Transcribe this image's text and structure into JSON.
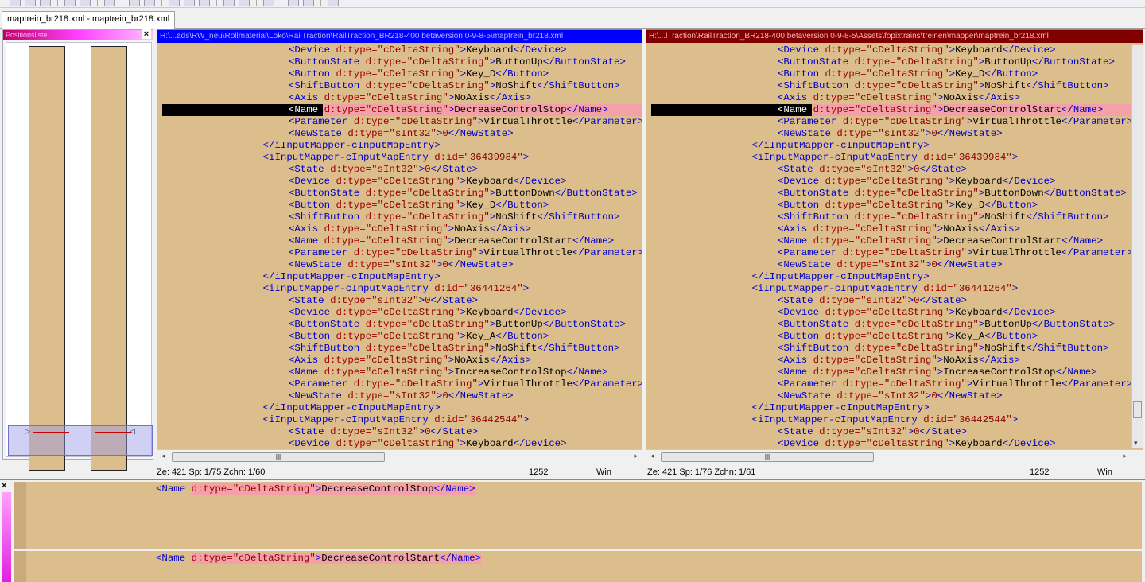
{
  "tab": {
    "label": "maptrein_br218.xml - maptrein_br218.xml"
  },
  "position_panel": {
    "title": "Positionsliste"
  },
  "left_pane": {
    "title": "H:\\...ads\\RW_neu\\Rollmaterial\\Loko\\RailTraction\\RailTraction_BR218-400 betaversion 0-9-8-5\\maptrein_br218.xml",
    "title_bg": "#0000ff",
    "status": {
      "pos": "Ze: 421   Sp: 1/75   Zchn: 1/60",
      "encoding": "1252",
      "lineend": "Win"
    }
  },
  "right_pane": {
    "title": "H:\\...lTraction\\RailTraction_BR218-400 betaversion 0-9-8-5\\Assets\\fopixtrains\\treinen\\mapper\\maptrein_br218.xml",
    "title_bg": "#800000",
    "status": {
      "pos": "Ze: 421   Sp: 1/76   Zchn: 1/61",
      "encoding": "1252",
      "lineend": "Win"
    }
  },
  "left_lines": [
    {
      "i": 5,
      "tag": "Device",
      "type": "cDeltaString",
      "val": "Keyboard"
    },
    {
      "i": 5,
      "tag": "ButtonState",
      "type": "cDeltaString",
      "val": "ButtonUp"
    },
    {
      "i": 5,
      "tag": "Button",
      "type": "cDeltaString",
      "val": "Key_D"
    },
    {
      "i": 5,
      "tag": "ShiftButton",
      "type": "cDeltaString",
      "val": "NoShift"
    },
    {
      "i": 5,
      "tag": "Axis",
      "type": "cDeltaString",
      "val": "NoAxis"
    },
    {
      "i": 5,
      "tag": "Name",
      "type": "cDeltaString",
      "val": "DecreaseControlStop",
      "diff": true
    },
    {
      "i": 5,
      "tag": "Parameter",
      "type": "cDeltaString",
      "val": "VirtualThrottle"
    },
    {
      "i": 5,
      "tag": "NewState",
      "type": "sInt32",
      "val": "0"
    },
    {
      "i": 4,
      "close": "iInputMapper-cInputMapEntry"
    },
    {
      "i": 4,
      "open": "iInputMapper-cInputMapEntry",
      "id": "36439984"
    },
    {
      "i": 5,
      "tag": "State",
      "type": "sInt32",
      "val": "0"
    },
    {
      "i": 5,
      "tag": "Device",
      "type": "cDeltaString",
      "val": "Keyboard"
    },
    {
      "i": 5,
      "tag": "ButtonState",
      "type": "cDeltaString",
      "val": "ButtonDown"
    },
    {
      "i": 5,
      "tag": "Button",
      "type": "cDeltaString",
      "val": "Key_D"
    },
    {
      "i": 5,
      "tag": "ShiftButton",
      "type": "cDeltaString",
      "val": "NoShift"
    },
    {
      "i": 5,
      "tag": "Axis",
      "type": "cDeltaString",
      "val": "NoAxis"
    },
    {
      "i": 5,
      "tag": "Name",
      "type": "cDeltaString",
      "val": "DecreaseControlStart"
    },
    {
      "i": 5,
      "tag": "Parameter",
      "type": "cDeltaString",
      "val": "VirtualThrottle"
    },
    {
      "i": 5,
      "tag": "NewState",
      "type": "sInt32",
      "val": "0"
    },
    {
      "i": 4,
      "close": "iInputMapper-cInputMapEntry"
    },
    {
      "i": 4,
      "open": "iInputMapper-cInputMapEntry",
      "id": "36441264"
    },
    {
      "i": 5,
      "tag": "State",
      "type": "sInt32",
      "val": "0"
    },
    {
      "i": 5,
      "tag": "Device",
      "type": "cDeltaString",
      "val": "Keyboard"
    },
    {
      "i": 5,
      "tag": "ButtonState",
      "type": "cDeltaString",
      "val": "ButtonUp"
    },
    {
      "i": 5,
      "tag": "Button",
      "type": "cDeltaString",
      "val": "Key_A"
    },
    {
      "i": 5,
      "tag": "ShiftButton",
      "type": "cDeltaString",
      "val": "NoShift"
    },
    {
      "i": 5,
      "tag": "Axis",
      "type": "cDeltaString",
      "val": "NoAxis"
    },
    {
      "i": 5,
      "tag": "Name",
      "type": "cDeltaString",
      "val": "IncreaseControlStop"
    },
    {
      "i": 5,
      "tag": "Parameter",
      "type": "cDeltaString",
      "val": "VirtualThrottle"
    },
    {
      "i": 5,
      "tag": "NewState",
      "type": "sInt32",
      "val": "0"
    },
    {
      "i": 4,
      "close": "iInputMapper-cInputMapEntry"
    },
    {
      "i": 4,
      "open": "iInputMapper-cInputMapEntry",
      "id": "36442544"
    },
    {
      "i": 5,
      "tag": "State",
      "type": "sInt32",
      "val": "0"
    },
    {
      "i": 5,
      "tag": "Device",
      "type": "cDeltaString",
      "val": "Keyboard"
    }
  ],
  "right_diff_name": "DecreaseControlStart",
  "line_compare": {
    "left": "<Name d:type=\"cDeltaString\">DecreaseControlStop</Name>",
    "right": "<Name d:type=\"cDeltaString\">DecreaseControlStart</Name>"
  },
  "scroll_thumb": "|||",
  "close_glyph": "×"
}
